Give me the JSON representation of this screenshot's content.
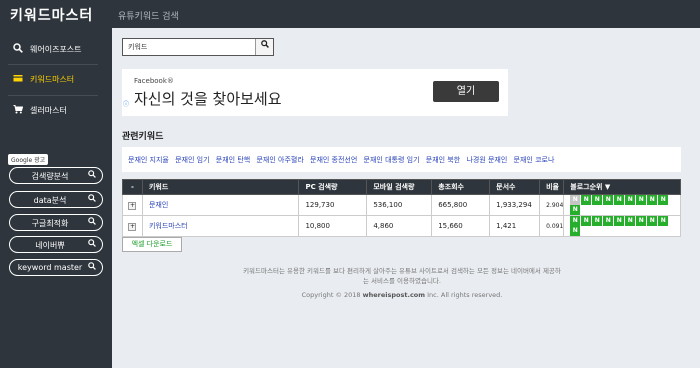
{
  "header": {
    "brand": "키워드마스터",
    "subtitle": "유튜키워드 검색"
  },
  "sidebar": {
    "menu": [
      {
        "label": "웨어이즈포스트",
        "icon": "search-icon"
      },
      {
        "label": "키워드마스터",
        "icon": "card-icon",
        "active": true
      },
      {
        "label": "셀러마스터",
        "icon": "cart-icon"
      }
    ],
    "google_badge": "Google 광고",
    "pills": [
      {
        "label": "검색량분석"
      },
      {
        "label": "data분석"
      },
      {
        "label": "구글최적화"
      },
      {
        "label": "네이버쀼"
      },
      {
        "label": "keyword master"
      }
    ]
  },
  "search": {
    "value": "키워드"
  },
  "ad": {
    "brand": "Facebook®",
    "headline": "자신의 것을 찾아보세요",
    "button": "열기"
  },
  "related": {
    "title": "관련키워드",
    "keywords": [
      "문재인 지지율",
      "문재인 임기",
      "문재인 탄핵",
      "문재인 아주혈라",
      "문재인 종전선언",
      "문재인 대통령 임기",
      "문재인 북한",
      "나경원 문재인",
      "문재인 코로나"
    ]
  },
  "table": {
    "headers": {
      "expand": "-",
      "keyword": "키워드",
      "pc": "PC 검색량",
      "mobile": "모바일 검색량",
      "total": "총조회수",
      "docs": "문서수",
      "ratio": "비율",
      "blog_rank": "블로그순위 ▼"
    },
    "rows": [
      {
        "expand": "+",
        "keyword": "문재인",
        "pc": "129,730",
        "mobile": "536,100",
        "total": "665,800",
        "docs": "1,933,294",
        "ratio": "2.904",
        "badges": [
          "N",
          "N",
          "N",
          "N",
          "N",
          "N",
          "N",
          "N",
          "N",
          "N"
        ],
        "first_badge_off": true
      },
      {
        "expand": "+",
        "keyword": "키워드마스터",
        "pc": "10,800",
        "mobile": "4,860",
        "total": "15,660",
        "docs": "1,421",
        "ratio": "0.091",
        "badges": [
          "N",
          "N",
          "N",
          "N",
          "N",
          "N",
          "N",
          "N",
          "N",
          "N"
        ],
        "first_badge_off": false
      }
    ]
  },
  "excel_button": "엑셀 다운로드",
  "footer": {
    "text": "키워드마스터는 유용한 키워드를 보다 편리하게 살아주는 유튜브 사이트로서 검색하는 모든 정보는 네이버에서 제공하는 서비스를 이용하였습니다.",
    "copyright_prefix": "Copyright © 2018",
    "copyright_site": "whereispost.com",
    "copyright_suffix": "Inc. All rights reserved."
  },
  "colors": {
    "sidebar_bg": "#2e353c",
    "accent_yellow": "#ffd200",
    "badge_green": "#27ae2c",
    "link_blue": "#2b44b8"
  }
}
